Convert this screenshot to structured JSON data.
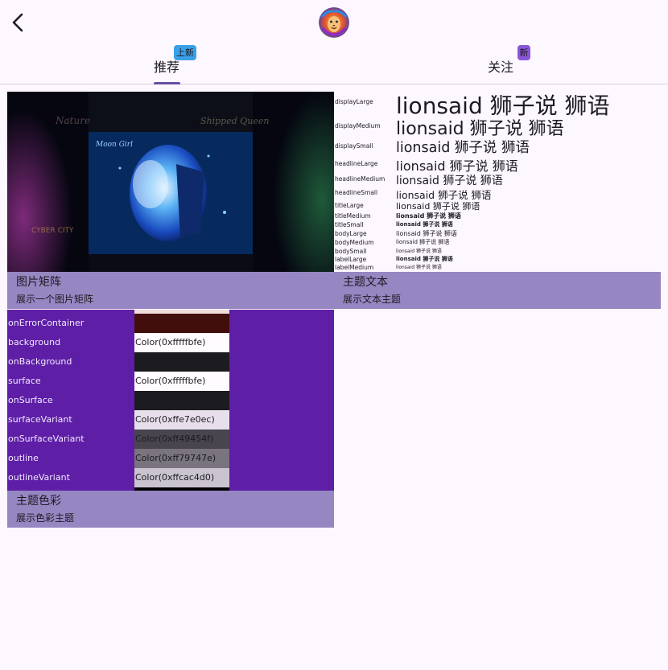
{
  "header": {
    "back_icon": "chevron-left-icon",
    "avatar_icon": "lion-avatar"
  },
  "tabs": [
    {
      "label": "推荐",
      "badge": "上新",
      "badge_color": "#3aa0e8"
    },
    {
      "label": "关注",
      "badge": "新",
      "badge_color": "#8a56d8"
    }
  ],
  "cards": {
    "image_grid": {
      "title": "图片矩阵",
      "subtitle": "展示一个图片矩阵",
      "poster_title": "Moon Girl"
    },
    "theme_text": {
      "title": "主题文本",
      "subtitle": "展示文本主题"
    },
    "theme_color": {
      "title": "主题色彩",
      "subtitle": "展示色彩主题"
    }
  },
  "typography": [
    {
      "name": "displayLarge",
      "sample": "lionsaid 狮子说 狮语"
    },
    {
      "name": "displayMedium",
      "sample": "lionsaid 狮子说 狮语"
    },
    {
      "name": "displaySmall",
      "sample": "lionsaid 狮子说 狮语"
    },
    {
      "name": "headlineLarge",
      "sample": "lionsaid 狮子说 狮语"
    },
    {
      "name": "headlineMedium",
      "sample": "lionsaid 狮子说 狮语"
    },
    {
      "name": "headlineSmall",
      "sample": "lionsaid 狮子说 狮语"
    },
    {
      "name": "titleLarge",
      "sample": "lionsaid 狮子说 狮语"
    },
    {
      "name": "titleMedium",
      "sample": "lionsaid 狮子说 狮语"
    },
    {
      "name": "titleSmall",
      "sample": "lionsaid 狮子说 狮语"
    },
    {
      "name": "bodyLarge",
      "sample": "lionsaid 狮子说 狮语"
    },
    {
      "name": "bodyMedium",
      "sample": "lionsaid 狮子说 狮语"
    },
    {
      "name": "bodySmall",
      "sample": "lionsaid 狮子说 狮语"
    },
    {
      "name": "labelLarge",
      "sample": "lionsaid 狮子说 狮语"
    },
    {
      "name": "labelMedium",
      "sample": "lionsaid 狮子说 狮语"
    }
  ],
  "colors": [
    {
      "name": "onErrorContainer",
      "value": "",
      "bg": "#410e0b",
      "fg": "#410e0b"
    },
    {
      "name": "background",
      "value": "Color(0xfffffbfe)",
      "bg": "#fffbfe",
      "fg": "#1c1b1f"
    },
    {
      "name": "onBackground",
      "value": "",
      "bg": "#1c1b1f",
      "fg": "#1c1b1f"
    },
    {
      "name": "surface",
      "value": "Color(0xfffffbfe)",
      "bg": "#fffbfe",
      "fg": "#1c1b1f"
    },
    {
      "name": "onSurface",
      "value": "",
      "bg": "#1c1b1f",
      "fg": "#1c1b1f"
    },
    {
      "name": "surfaceVariant",
      "value": "Color(0xffe7e0ec)",
      "bg": "#e7e0ec",
      "fg": "#1c1b1f"
    },
    {
      "name": "onSurfaceVariant",
      "value": "Color(0xff49454f)",
      "bg": "#49454f",
      "fg": "#1c1b1f"
    },
    {
      "name": "outline",
      "value": "Color(0xff79747e)",
      "bg": "#79747e",
      "fg": "#1c1b1f"
    },
    {
      "name": "outlineVariant",
      "value": "Color(0xffcac4d0)",
      "bg": "#cac4d0",
      "fg": "#1c1b1f"
    }
  ],
  "palette": {
    "accent": "#6750a4",
    "caption_bg": "#9686c2",
    "color_card_bg": "#5e1ea6"
  }
}
